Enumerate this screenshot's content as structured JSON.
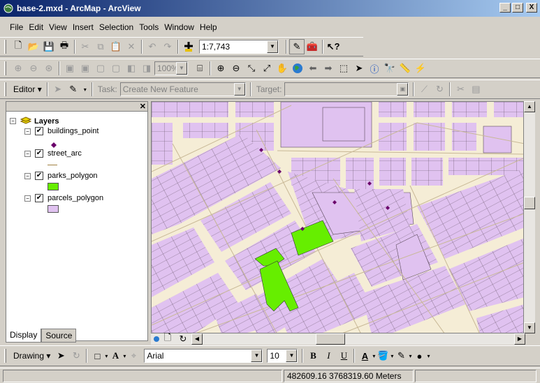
{
  "window": {
    "title": "base-2.mxd - ArcMap - ArcView",
    "minimize": "_",
    "maximize": "□",
    "close": "X"
  },
  "menu": [
    "File",
    "Edit",
    "View",
    "Insert",
    "Selection",
    "Tools",
    "Window",
    "Help"
  ],
  "toolbar1": {
    "scale": "1:7,743"
  },
  "toolbar2": {
    "zoom_percent": "100%"
  },
  "editor": {
    "editor_label": "Editor",
    "task_label": "Task:",
    "task_value": "Create New Feature",
    "target_label": "Target:",
    "target_value": ""
  },
  "toc": {
    "root": "Layers",
    "layers": [
      {
        "name": "buildings_point",
        "checked": true
      },
      {
        "name": "street_arc",
        "checked": true
      },
      {
        "name": "parks_polygon",
        "checked": true
      },
      {
        "name": "parcels_polygon",
        "checked": true
      }
    ],
    "tabs": [
      "Display",
      "Source"
    ]
  },
  "colors": {
    "parcel": "#e0c2f0",
    "park": "#66ee00",
    "street": "#f5edd6",
    "point": "#6b006b"
  },
  "drawing": {
    "drawing_label": "Drawing",
    "font": "Arial",
    "font_size": "10",
    "bold": "B",
    "italic": "I",
    "underline": "U"
  },
  "status": {
    "coords": "482609.16  3768319.60 Meters"
  }
}
